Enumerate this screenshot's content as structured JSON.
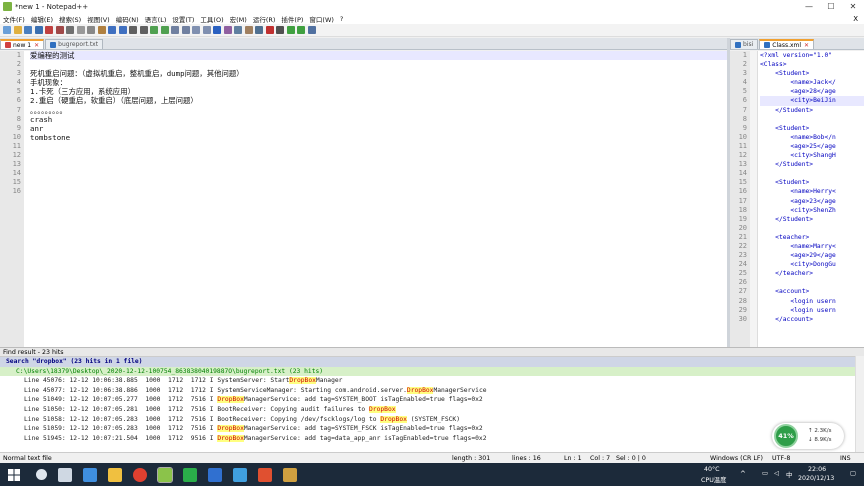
{
  "window": {
    "title": "*new 1 - Notepad++",
    "min": "—",
    "max": "☐",
    "close": "✕"
  },
  "menu": [
    "文件(F)",
    "编辑(E)",
    "搜索(S)",
    "视图(V)",
    "编码(N)",
    "语言(L)",
    "设置(T)",
    "工具(O)",
    "宏(M)",
    "运行(R)",
    "插件(P)",
    "窗口(W)",
    "?"
  ],
  "menu_close": "X",
  "left_tabs": [
    {
      "label": "new 1",
      "active": true
    },
    {
      "label": "bugreport.txt",
      "active": false
    }
  ],
  "right_tabs": [
    {
      "label": "bisi",
      "active": false
    },
    {
      "label": "Class.xml",
      "active": true
    }
  ],
  "editor": {
    "line_numbers": [
      "1",
      "2",
      "3",
      "4",
      "5",
      "6",
      "7",
      "8",
      "9",
      "10",
      "11",
      "12",
      "13",
      "14",
      "15",
      "16"
    ],
    "lines": [
      "爱编程的测试",
      "",
      "死机重启问题：（虚拟机重启，整机重启，dump问题，其他问题）",
      "手机现象：",
      "1.卡死（三方应用，系统应用）",
      "2.重启（硬重启，软重启）（底层问题，上层问题）",
      "。。。。。。。。。",
      "crash",
      "anr",
      "tombstone",
      "",
      "",
      "",
      "",
      "",
      ""
    ]
  },
  "xml_editor": {
    "line_numbers": [
      "1",
      "2",
      "3",
      "4",
      "5",
      "6",
      "7",
      "8",
      "9",
      "10",
      "11",
      "12",
      "13",
      "14",
      "15",
      "16",
      "17",
      "18",
      "19",
      "20",
      "21",
      "22",
      "23",
      "24",
      "25",
      "26",
      "27",
      "28",
      "29",
      "30"
    ],
    "lines": [
      "<?xml version=\"1.0\"",
      "<Class>",
      "    <Student>",
      "        <name>Jack</",
      "        <age>28</age",
      "        <city>BeiJin",
      "    </Student>",
      "",
      "    <Student>",
      "        <name>Bob</n",
      "        <age>25</age",
      "        <city>ShangH",
      "    </Student>",
      "",
      "    <Student>",
      "        <name>Herry<",
      "        <age>23</age",
      "        <city>ShenZh",
      "    </Student>",
      "",
      "    <teacher>",
      "        <name>Marry<",
      "        <age>29</age",
      "        <city>DongGu",
      "    </teacher>",
      "",
      "    <account>",
      "        <login usern",
      "        <login usern",
      "    </account>"
    ]
  },
  "find": {
    "title": "Find result - 23 hits",
    "search_line": "Search \"dropbox\" (23 hits in 1 file)",
    "file_line": "C:\\Users\\18379\\Desktop\\_2020-12-12-100754_86383804019887O\\bugreport.txt (23 hits)",
    "hits": [
      [
        "Line 45076: 12-12 10:06:38.885  1000  1712  1712 I SystemServer: Start",
        "DropBox",
        "Manager"
      ],
      [
        "Line 45077: 12-12 10:06:38.886  1000  1712  1712 I SystemServiceManager: Starting com.android.server.",
        "DropBox",
        "ManagerService"
      ],
      [
        "Line 51049: 12-12 10:07:05.277  1000  1712  7516 I ",
        "DropBox",
        "ManagerService: add tag=SYSTEM_BOOT isTagEnabled=true flags=0x2"
      ],
      [
        "Line 51050: 12-12 10:07:05.281  1000  1712  7516 I BootReceiver: Copying audit failures to ",
        "DropBox",
        ""
      ],
      [
        "Line 51058: 12-12 10:07:05.283  1000  1712  7516 I BootReceiver: Copying /dev/fscklogs/log to ",
        "DropBox",
        " (SYSTEM_FSCK)"
      ],
      [
        "Line 51059: 12-12 10:07:05.283  1000  1712  7516 I ",
        "DropBox",
        "ManagerService: add tag=SYSTEM_FSCK isTagEnabled=true flags=0x2"
      ],
      [
        "Line 51945: 12-12 10:07:21.504  1000  1712  9516 I ",
        "DropBox",
        "ManagerService: add tag=data_app_anr isTagEnabled=true flags=0x2"
      ]
    ]
  },
  "status": {
    "type": "Normal text file",
    "length": "length : 301",
    "lines": "lines : 16",
    "ln": "Ln : 1",
    "col": "Col : 7",
    "sel": "Sel : 0 | 0",
    "eol": "Windows (CR LF)",
    "enc": "UTF-8",
    "mode": "INS"
  },
  "netwidget": {
    "percent": "41%",
    "up": "2.3K/s",
    "down": "8.9K/s"
  },
  "tray": {
    "temp": "40°C",
    "cpu": "CPU温度",
    "time": "22:06",
    "date": "2020/12/13",
    "lang": "中"
  },
  "colors": {
    "tab_active_accent": "#f0a030",
    "find_highlight": "#ffff80",
    "taskbar": "#1c2a3a",
    "widget_green": "#2e9e48"
  }
}
